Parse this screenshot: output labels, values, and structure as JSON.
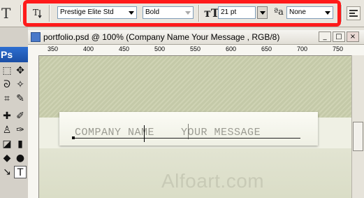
{
  "options_bar": {
    "tool_icon": "T",
    "font_family": "Prestige Elite Std",
    "font_style": "Bold",
    "font_size": "21 pt",
    "antialias": "None",
    "icons": [
      "orientation-toggle-icon",
      "font-size-icon",
      "antialias-icon",
      "align-left-icon"
    ]
  },
  "document": {
    "title": "portfolio.psd @ 100% (Company Name  Your Message , RGB/8)",
    "ruler_labels": [
      "350",
      "400",
      "450",
      "500",
      "550",
      "600",
      "650",
      "700",
      "750"
    ]
  },
  "canvas": {
    "headline_left": "COMPANY NAME",
    "headline_right": "YOUR MESSAGE",
    "watermark": "Alfoart.com"
  },
  "toolbox": {
    "logo": "Ps"
  },
  "colors": {
    "highlight_frame": "#ff1a1a",
    "canvas_bg": "#cfd3b4",
    "headline_text": "#9b9b92"
  }
}
